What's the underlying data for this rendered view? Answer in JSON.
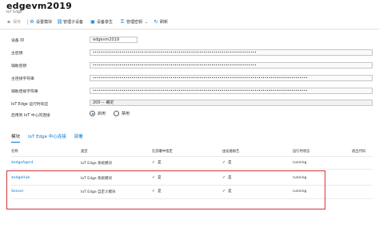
{
  "header": {
    "title": "edgevm2019",
    "subtitle": "IoT Edge"
  },
  "toolbar": {
    "items": [
      {
        "label": "保存",
        "icon": "save-icon",
        "disabled": true
      },
      {
        "label": "设置模块",
        "icon": "gear-icon",
        "disabled": false
      },
      {
        "label": "管理子设备",
        "icon": "device-tree-icon",
        "disabled": false
      },
      {
        "label": "设备孪生",
        "icon": "twin-icon",
        "disabled": false
      },
      {
        "label": "管理密钥",
        "icon": "key-icon",
        "disabled": false
      },
      {
        "label": "刷新",
        "icon": "refresh-icon",
        "disabled": false
      }
    ]
  },
  "form": {
    "device_id_label": "设备 ID",
    "device_id_value": "edgevm2019",
    "primary_key_label": "主密钥",
    "primary_key_value": "••••••••••••••••••••••••••••••••••••••••••••••••••••••••••••••••••••••••••••••••",
    "secondary_key_label": "辅助密钥",
    "secondary_key_value": "••••••••••••••••••••••••••••••••••••••••••••••••••••••••••••••••••••••••••••••••",
    "primary_conn_label": "主连接字符串",
    "primary_conn_value": "•••••••••••••••••••••••••••••••••••••••••••••••••••••••••••••••••••••••••••••••••••••••••••••••••••••••••",
    "secondary_conn_label": "辅助连接字符串",
    "secondary_conn_value": "•••••••••••••••••••••••••••••••••••••••••••••••••••••••••••••••••••••••••••••••••••••••••••••••••••••••••",
    "runtime_status_label": "IoT Edge 运行时响应",
    "runtime_status_value": "200 -- 确定",
    "hub_connect_label": "启用到 IoT 中心的连接",
    "radio_enable": "启用",
    "radio_disable": "禁用"
  },
  "tabs": [
    {
      "label": "模块",
      "active": true
    },
    {
      "label": "IoT Edge 中心连接",
      "active": false
    },
    {
      "label": "部署",
      "active": false
    }
  ],
  "table": {
    "headers": [
      "名称",
      "类型",
      "在部署中指定",
      "由设备报告",
      "运行时状态",
      "退出代码"
    ],
    "rows": [
      {
        "name": "$edgeAgent",
        "type": "IoT Edge 系统模块",
        "specified": "是",
        "reported": "是",
        "status": "running",
        "exit": ""
      },
      {
        "name": "$edgeHub",
        "type": "IoT Edge 系统模块",
        "specified": "是",
        "reported": "是",
        "status": "running",
        "exit": ""
      },
      {
        "name": "Sensor",
        "type": "IoT Edge 自定义模块",
        "specified": "是",
        "reported": "是",
        "status": "running",
        "exit": ""
      }
    ]
  },
  "colors": {
    "accent": "#0078d4",
    "highlight": "#d13438"
  }
}
